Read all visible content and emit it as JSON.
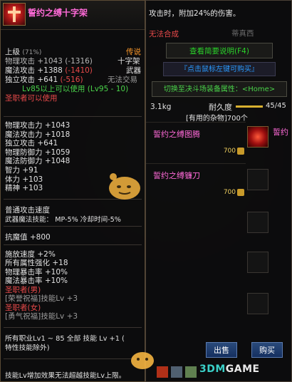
{
  "tooltip": {
    "name": "誓约之缚十字架",
    "grade": "上级",
    "grade_pct": "(71%)",
    "rarity": "传说",
    "phys_atk": "物理攻击 +1043",
    "phys_atk_diff": "(-1316)",
    "type_line1": "十字架",
    "mag_atk": "魔法攻击 +1388",
    "mag_atk_diff": "(-1410)",
    "type_line2": "武器",
    "ind_atk": "独立攻击 +641",
    "ind_atk_diff": "(-516)",
    "trade": "无法交易",
    "level_req": "Lv85以上可以使用 (Lv95 - 10)",
    "job": "圣职者可以使用",
    "stats": [
      "物理攻击力 +1043",
      "魔法攻击力 +1018",
      "独立攻击 +641",
      "物理防御力 +1059",
      "魔法防御力 +1048",
      "智力 +91",
      "体力 +103",
      "精神 +103"
    ],
    "atk_speed": "普通攻击速度",
    "weapon_skill": "武器魔法技能： MP-5% 冷却时间-5%",
    "resist": "抗魔值 +800",
    "bonus": [
      "施放速度 +2%",
      "所有属性强化 +18",
      "物理暴击率 +10%",
      "魔法暴击率 +10%"
    ],
    "cond": [
      "圣职者(男)",
      "[荣誉祝福]技能Lv +3",
      "圣职者(女)",
      "[勇气祝福]技能Lv +3"
    ],
    "all_job": "所有职业Lv1 ~ 85 全部 技能 Lv +1 (",
    "all_job2": "特性技能除外)",
    "footer": "技能Lv增加效果无法超越技能Lv上限。"
  },
  "panel": {
    "desc": "攻击时，附加24%的伤害。",
    "cannot": "无法合成",
    "seller": "蒂真西",
    "btn_f4": "查看简要说明(F4)",
    "btn_buy_sel": "『点击鼠标左键可购买』",
    "btn_home": "切换至决斗场装备属性：<Home>",
    "weight": "3.1kg",
    "durability_label": "耐久度",
    "durability": "45/45",
    "misc": "[有用的杂物]700个",
    "durability_fraction": 1.0
  },
  "shop": {
    "items": [
      {
        "name": "誓约之缚图腾",
        "price": "700"
      },
      {
        "name": "誓约之缚镰刀",
        "price": "700"
      }
    ],
    "right_item": "誓约"
  },
  "buttons": {
    "sell": "出售",
    "buy": "购买"
  },
  "watermark": {
    "num": "3DM",
    "game": "GAME"
  },
  "colors": {
    "epic_name": "#ff6ad8",
    "price": "#f0d060",
    "button_blue": "#2a4a7a"
  }
}
